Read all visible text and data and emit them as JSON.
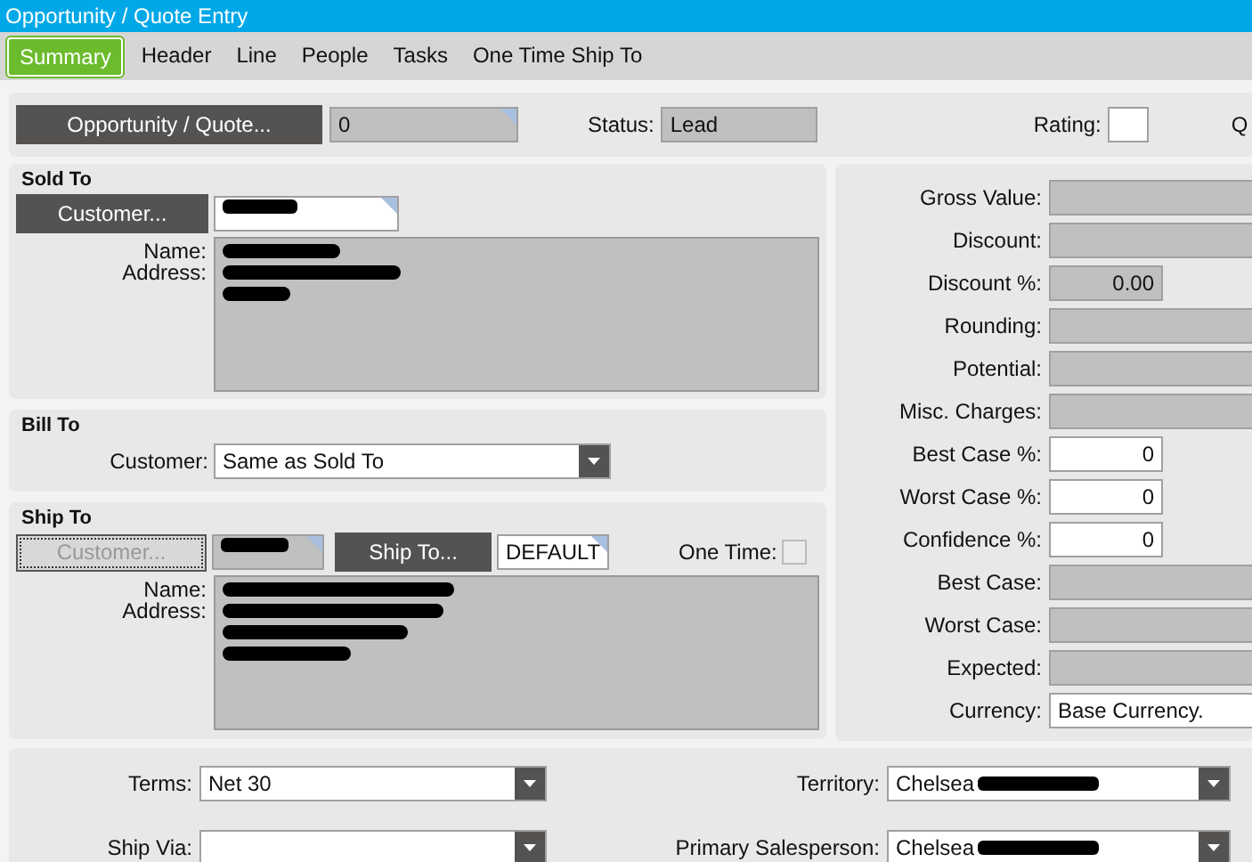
{
  "window": {
    "title": "Opportunity / Quote Entry"
  },
  "tabs": [
    {
      "label": "Summary",
      "selected": true
    },
    {
      "label": "Header",
      "selected": false
    },
    {
      "label": "Line",
      "selected": false
    },
    {
      "label": "People",
      "selected": false
    },
    {
      "label": "Tasks",
      "selected": false
    },
    {
      "label": "One Time Ship To",
      "selected": false
    }
  ],
  "top": {
    "button": "Opportunity / Quote...",
    "number": "0",
    "status_label": "Status:",
    "status": "Lead",
    "rating_label": "Rating:",
    "cut_label": "Q"
  },
  "sold_to": {
    "title": "Sold To",
    "button": "Customer...",
    "customer_redacted": true,
    "name_label": "Name:",
    "address_label": "Address:",
    "address_redacted": true
  },
  "bill_to": {
    "title": "Bill To",
    "customer_label": "Customer:",
    "customer": "Same as Sold To"
  },
  "ship_to": {
    "title": "Ship To",
    "button": "Customer...",
    "button_disabled": true,
    "customer_redacted": true,
    "ship_button": "Ship To...",
    "ship_code": "DEFAULT",
    "one_time_label": "One Time:",
    "one_time": false,
    "name_label": "Name:",
    "address_label": "Address:",
    "address_redacted": true
  },
  "values": [
    {
      "label": "Gross Value:",
      "kind": "display"
    },
    {
      "label": "Discount:",
      "kind": "display"
    },
    {
      "label": "Discount %:",
      "kind": "short",
      "value": "0.00"
    },
    {
      "label": "Rounding:",
      "kind": "display"
    },
    {
      "label": "Potential:",
      "kind": "display"
    },
    {
      "label": "Misc. Charges:",
      "kind": "display"
    },
    {
      "label": "Best Case %:",
      "kind": "input",
      "value": "0"
    },
    {
      "label": "Worst Case %:",
      "kind": "input",
      "value": "0"
    },
    {
      "label": "Confidence %:",
      "kind": "input",
      "value": "0"
    },
    {
      "label": "Best Case:",
      "kind": "display"
    },
    {
      "label": "Worst Case:",
      "kind": "display"
    },
    {
      "label": "Expected:",
      "kind": "display"
    },
    {
      "label": "Currency:",
      "kind": "text",
      "value": "Base Currency."
    }
  ],
  "bottom": {
    "left": [
      {
        "label": "Terms:",
        "value": "Net 30",
        "redacted": false
      },
      {
        "label": "Ship Via:",
        "redacted": false
      }
    ],
    "right": [
      {
        "label": "Territory:",
        "value": "Chelsea",
        "redacted": true
      },
      {
        "label": "Primary Salesperson:",
        "value": "Chelsea",
        "redacted": true
      }
    ]
  }
}
